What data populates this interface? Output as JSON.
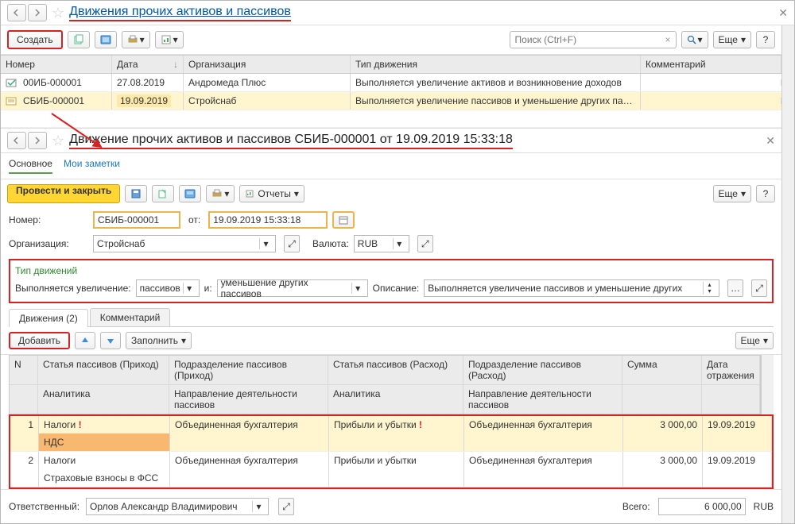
{
  "top": {
    "title": "Движения прочих активов и пассивов",
    "create_label": "Создать",
    "search_placeholder": "Поиск (Ctrl+F)",
    "more_label": "Еще",
    "columns": {
      "num": "Номер",
      "date": "Дата",
      "org": "Организация",
      "type": "Тип движения",
      "comment": "Комментарий"
    },
    "rows": [
      {
        "num": "00ИБ-000001",
        "date": "27.08.2019",
        "date_hl": false,
        "org": "Андромеда Плюс",
        "type": "Выполняется увеличение активов и возникновение доходов",
        "selected": false,
        "posted": true
      },
      {
        "num": "СБИБ-000001",
        "date": "19.09.2019",
        "date_hl": true,
        "org": "Стройснаб",
        "type": "Выполняется увеличение пассивов и уменьшение других пассивов",
        "selected": true,
        "posted": false
      }
    ]
  },
  "doc": {
    "title": "Движение прочих активов и пассивов СБИБ-000001 от 19.09.2019 15:33:18",
    "subnav": {
      "main": "Основное",
      "notes": "Мои заметки"
    },
    "post_close_label": "Провести и закрыть",
    "reports_label": "Отчеты",
    "more_label": "Еще",
    "number_label": "Номер:",
    "number": "СБИБ-000001",
    "from_label": "от:",
    "date": "19.09.2019 15:33:18",
    "org_label": "Организация:",
    "org": "Стройснаб",
    "currency_label": "Валюта:",
    "currency": "RUB",
    "type_section_title": "Тип движений",
    "incr_label": "Выполняется увеличение:",
    "incr_value": "пассивов",
    "and_label": "и:",
    "decr_value": "уменьшение других пассивов",
    "desc_label": "Описание:",
    "desc_value": "Выполняется увеличение пассивов и уменьшение других",
    "tabs": {
      "lines": "Движения (2)",
      "comment": "Комментарий"
    },
    "add_label": "Добавить",
    "fill_label": "Заполнить",
    "lines_more_label": "Еще",
    "line_cols1": {
      "n": "N",
      "art_in": "Статья пассивов (Приход)",
      "dept_in": "Подразделение пассивов (Приход)",
      "art_out": "Статья пассивов (Расход)",
      "dept_out": "Подразделение пассивов (Расход)",
      "sum": "Сумма",
      "date": "Дата отражения"
    },
    "line_cols2": {
      "analytics": "Аналитика",
      "dir": "Направление деятельности пассивов",
      "analytics2": "Аналитика",
      "dir2": "Направление деятельности пассивов"
    },
    "lines": [
      {
        "n": "1",
        "art_in": "Налоги",
        "art_in_warn": true,
        "dept_in": "Объединенная бухгалтерия",
        "art_out": "Прибыли и убытки",
        "art_out_warn": true,
        "dept_out": "Объединенная бухгалтерия",
        "sum": "3 000,00",
        "date": "19.09.2019",
        "sub": "НДС",
        "sub_hl": true
      },
      {
        "n": "2",
        "art_in": "Налоги",
        "art_in_warn": false,
        "dept_in": "Объединенная бухгалтерия",
        "art_out": "Прибыли и убытки",
        "art_out_warn": false,
        "dept_out": "Объединенная бухгалтерия",
        "sum": "3 000,00",
        "date": "19.09.2019",
        "sub": "Страховые взносы в ФСС",
        "sub_hl": false
      }
    ],
    "resp_label": "Ответственный:",
    "resp_value": "Орлов Александр Владимирович",
    "total_label": "Всего:",
    "total_value": "6 000,00",
    "total_cur": "RUB"
  }
}
